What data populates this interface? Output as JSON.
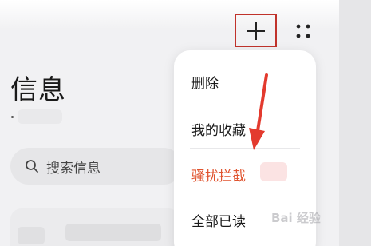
{
  "header": {
    "add_icon": "plus-icon",
    "more_icon": "grid-dots-icon",
    "highlight_color": "#c0322b"
  },
  "page": {
    "title": "信息"
  },
  "search": {
    "icon": "search-icon",
    "placeholder": "搜索信息"
  },
  "menu": {
    "items": [
      {
        "label": "删除"
      },
      {
        "label": "我的收藏"
      },
      {
        "label": "骚扰拦截",
        "color": "#e0542f"
      },
      {
        "label": "全部已读"
      }
    ]
  },
  "annotation": {
    "arrow_color": "#e33a2e"
  },
  "watermark": {
    "text": "Bai 经验"
  }
}
